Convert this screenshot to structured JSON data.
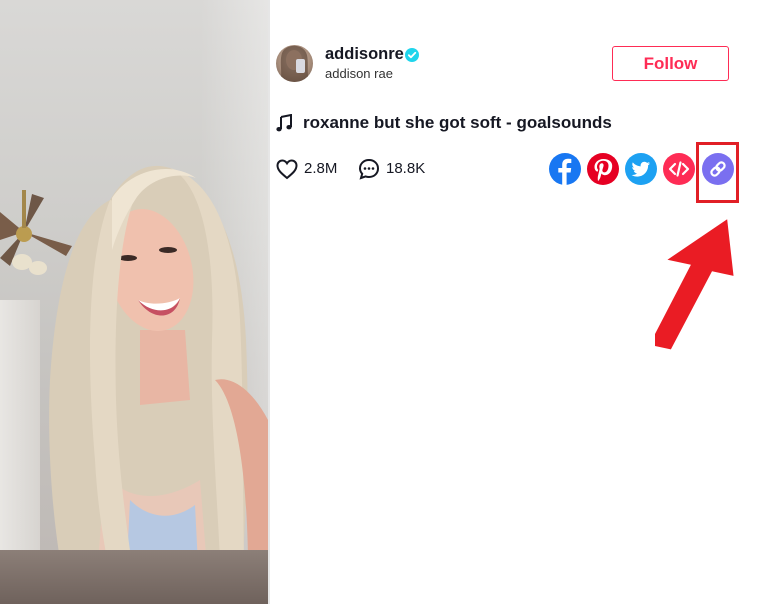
{
  "profile": {
    "username": "addisonre",
    "nickname": "addison rae",
    "verified": true,
    "avatar_icon": "avatar-photo"
  },
  "follow_button": {
    "label": "Follow"
  },
  "music": {
    "icon": "music-note-icon",
    "title": "roxanne but she got soft - goalsounds"
  },
  "stats": {
    "likes": "2.8M",
    "comments": "18.8K",
    "like_icon": "heart-icon",
    "comment_icon": "comment-icon"
  },
  "share_buttons": [
    {
      "name": "facebook-icon",
      "color": "#1877f2"
    },
    {
      "name": "pinterest-icon",
      "color": "#e60023"
    },
    {
      "name": "twitter-icon",
      "color": "#1da1f2"
    },
    {
      "name": "embed-icon",
      "color": "#fe2c55"
    },
    {
      "name": "copy-link-icon",
      "color": "#7a6ff0"
    }
  ],
  "annotation": {
    "highlight_color": "#e11f26",
    "arrow_color": "#ea1c24",
    "target": "copy-link-button"
  },
  "video": {
    "description": "video-preview"
  }
}
